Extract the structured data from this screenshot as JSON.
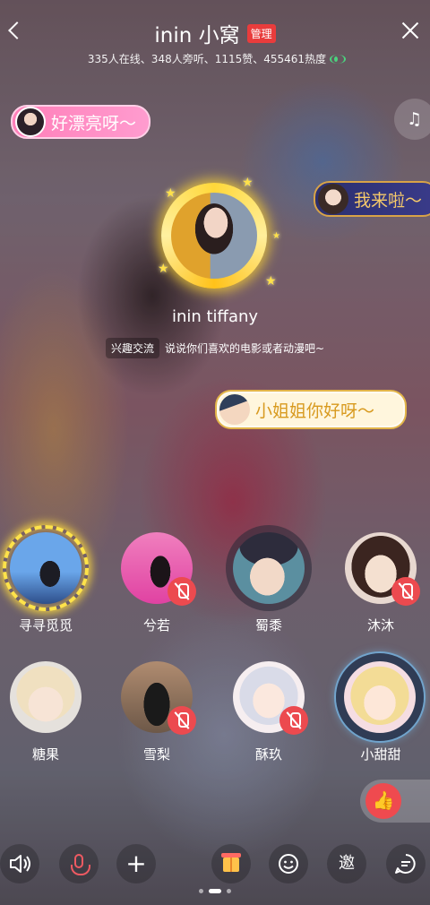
{
  "header": {
    "title": "inin 小窝",
    "admin_badge": "管理",
    "stats": "335人在线、348人旁听、1115赞、455461热度"
  },
  "bubbles": [
    {
      "text": "好漂亮呀～"
    },
    {
      "text": "我来啦～"
    },
    {
      "text": "小姐姐你好呀～"
    }
  ],
  "host": {
    "name": "inin tiffany",
    "topic_tag": "兴趣交流",
    "topic_text": "说说你们喜欢的电影或者动漫吧~"
  },
  "seats": [
    {
      "name": "寻寻觅觅",
      "muted": false
    },
    {
      "name": "兮若",
      "muted": true
    },
    {
      "name": "蜀黍",
      "muted": false
    },
    {
      "name": "沐沐",
      "muted": true
    },
    {
      "name": "糖果",
      "muted": false
    },
    {
      "name": "雪梨",
      "muted": true
    },
    {
      "name": "酥玖",
      "muted": true
    },
    {
      "name": "小甜甜",
      "muted": false
    }
  ],
  "bottom_bar": {
    "invite_label": "邀"
  },
  "icons": {
    "back": "chevron-left-icon",
    "close": "close-icon",
    "music": "music-note-icon",
    "like": "thumbs-up-icon",
    "speaker": "speaker-icon",
    "mic": "microphone-icon",
    "add": "plus-icon",
    "gift": "gift-icon",
    "emoji": "emoji-icon",
    "chat": "chat-bubble-icon"
  },
  "colors": {
    "accent_red": "#ec4a4f",
    "host_ring": "#ffd83a",
    "online_green": "#4ad47e"
  },
  "pager": {
    "pages": 3,
    "active": 2
  }
}
